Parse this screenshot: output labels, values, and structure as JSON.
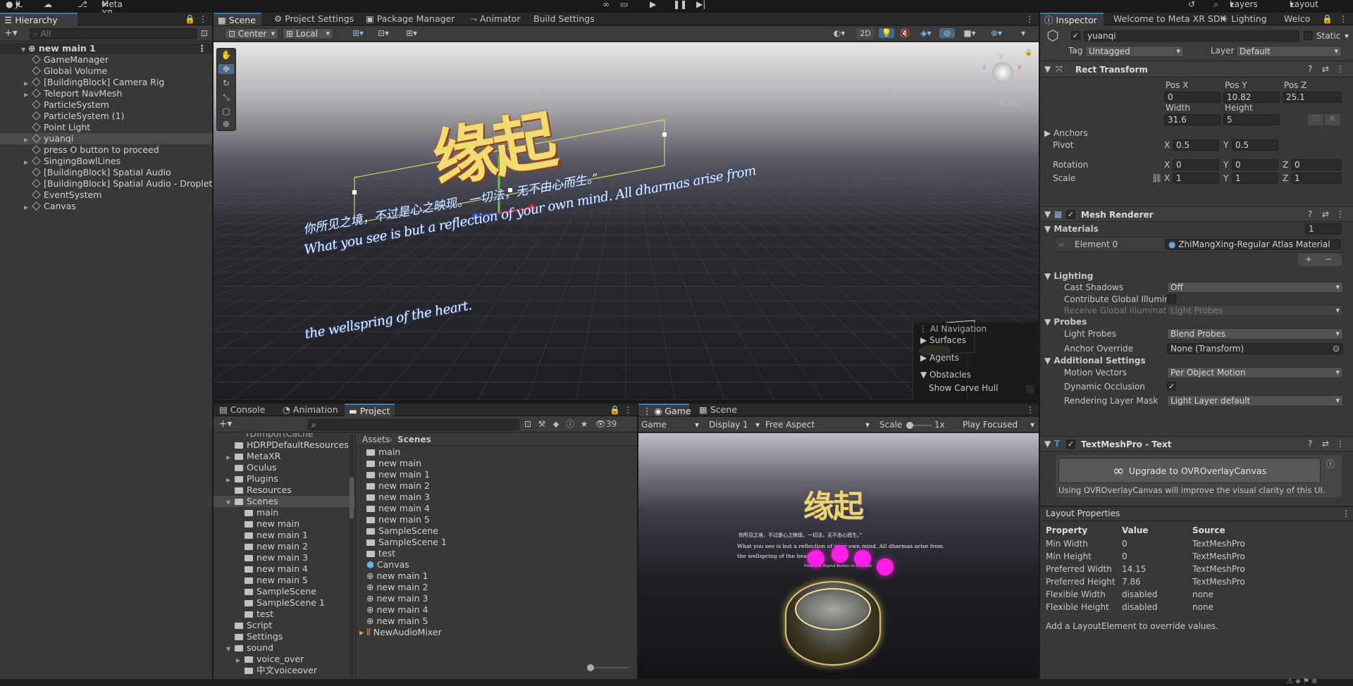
{
  "toolbar": {
    "account": "JL",
    "xr_tools": "Meta XR Tools",
    "layers": "Layers",
    "layout": "Layout"
  },
  "hierarchy": {
    "tab": "Hierarchy",
    "search_placeholder": "All",
    "root": "new main 1",
    "items": [
      "GameManager",
      "Global Volume",
      "[BuildingBlock] Camera Rig",
      "Teleport NavMesh",
      "ParticleSystem",
      "ParticleSystem (1)",
      "Point Light",
      "yuanqi",
      "press O button to proceed",
      "SingingBowlLines",
      "[BuildingBlock] Spatial Audio",
      "[BuildingBlock] Spatial Audio - Droplet",
      "EventSystem",
      "Canvas"
    ]
  },
  "scene_tabs": [
    "Scene",
    "Project Settings",
    "Package Manager",
    "Animator",
    "Build Settings"
  ],
  "scene_toolbar": {
    "pivot": "Center",
    "space": "Local",
    "mode_2d": "2D"
  },
  "scene_view": {
    "iso": "Iso",
    "title_chars": "缘起",
    "quote_cn": "你所见之境，不过是心之映现。一切法，无不由心而生。”",
    "quote_en_1": "What you see is but a reflection of your own mind. All dharmas arise from",
    "quote_en_2": "the wellspring of the heart."
  },
  "ai_nav": {
    "title": "AI Navigation",
    "items": [
      "Surfaces",
      "Agents",
      "Obstacles"
    ],
    "option": "Show Carve Hull"
  },
  "bottom_tabs": [
    "Console",
    "Animation",
    "Project"
  ],
  "project": {
    "hidden_count": "39",
    "tree": [
      "HDRPDefaultResources",
      "MetaXR",
      "Oculus",
      "Plugins",
      "Resources",
      "Scenes",
      "main",
      "new main",
      "new main 1",
      "new main 2",
      "new main 3",
      "new main 4",
      "new main 5",
      "SampleScene",
      "SampleScene 1",
      "test",
      "Script",
      "Settings",
      "sound",
      "voice_over",
      "中文voiceover"
    ],
    "tree_top_partial": "TDImportCache",
    "breadcrumb": [
      "Assets",
      "Scenes"
    ],
    "files": [
      "main",
      "new main",
      "new main 1",
      "new main 2",
      "new main 3",
      "new main 4",
      "new main 5",
      "SampleScene",
      "SampleScene 1",
      "test",
      "Canvas",
      "new main 1",
      "new main 2",
      "new main 3",
      "new main 4",
      "new main 5",
      "NewAudioMixer"
    ]
  },
  "game": {
    "tabs": [
      "Game",
      "Scene"
    ],
    "display_mode": "Game",
    "display": "Display 1",
    "aspect": "Free Aspect",
    "scale_label": "Scale",
    "scale_value": "1x",
    "play_mode": "Play Focused",
    "title_chars": "缘起",
    "quote_cn": "你所见之境，不过是心之映现。一切法，无不由心而生。”",
    "quote_en_1": "What you see is but a reflection of your own mind. All dharmas arise from",
    "quote_en_2": "the wellspring of the heart",
    "prompt": "Press the Round Button to Proceed"
  },
  "inspector": {
    "tabs": [
      "Inspector",
      "Welcome to Meta XR SDK",
      "Lighting",
      "Welco"
    ],
    "name": "yuanqi",
    "static": "Static",
    "tag_label": "Tag",
    "tag": "Untagged",
    "layer_label": "Layer",
    "layer": "Default",
    "rect": {
      "title": "Rect Transform",
      "pos_x_label": "Pos X",
      "pos_y_label": "Pos Y",
      "pos_z_label": "Pos Z",
      "pos_x": "0",
      "pos_y": "10.82",
      "pos_z": "25.1",
      "width_label": "Width",
      "height_label": "Height",
      "width": "31.6",
      "height": "5",
      "r": "R",
      "anchors": "Anchors",
      "pivot": "Pivot",
      "pivot_x": "0.5",
      "pivot_y": "0.5",
      "rotation": "Rotation",
      "rot_x": "0",
      "rot_y": "0",
      "rot_z": "0",
      "scale": "Scale",
      "scale_x": "1",
      "scale_y": "1",
      "scale_z": "1"
    },
    "mesh": {
      "title": "Mesh Renderer",
      "materials": "Materials",
      "materials_count": "1",
      "element0": "Element 0",
      "material": "ZhiMangXing-Regular Atlas Material",
      "lighting": "Lighting",
      "cast_shadows": "Cast Shadows",
      "cast_shadows_val": "Off",
      "contribute_gi": "Contribute Global Illumina",
      "receive_gi": "Receive Global Illuminatio",
      "receive_gi_val": "Light Probes",
      "probes": "Probes",
      "light_probes": "Light Probes",
      "light_probes_val": "Blend Probes",
      "anchor_override": "Anchor Override",
      "anchor_override_val": "None (Transform)",
      "additional": "Additional Settings",
      "motion_vectors": "Motion Vectors",
      "motion_vectors_val": "Per Object Motion",
      "dynamic_occlusion": "Dynamic Occlusion",
      "rendering_layer": "Rendering Layer Mask",
      "rendering_layer_val": "Light Layer default"
    },
    "tmp": {
      "title": "TextMeshPro - Text",
      "upgrade": "Upgrade to OVROverlayCanvas",
      "note": "Using OVROverlayCanvas will improve the visual clarity of this UI."
    }
  },
  "layout_props": {
    "title": "Layout Properties",
    "headers": [
      "Property",
      "Value",
      "Source"
    ],
    "rows": [
      [
        "Min Width",
        "0",
        "TextMeshPro"
      ],
      [
        "Min Height",
        "0",
        "TextMeshPro"
      ],
      [
        "Preferred Width",
        "14.15",
        "TextMeshPro"
      ],
      [
        "Preferred Height",
        "7.86",
        "TextMeshPro"
      ],
      [
        "Flexible Width",
        "disabled",
        "none"
      ],
      [
        "Flexible Height",
        "disabled",
        "none"
      ]
    ],
    "footer": "Add a LayoutElement to override values."
  },
  "colors": {
    "accent": "#3a79bb",
    "title_gold": "#e9d27a",
    "magenta": "#ff1ee6"
  }
}
